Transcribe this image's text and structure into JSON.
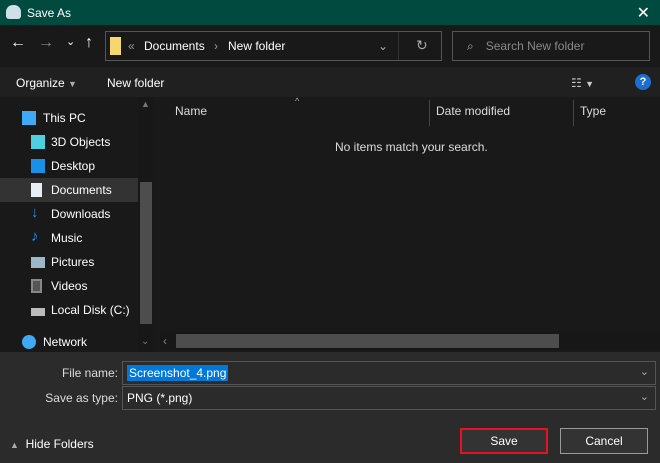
{
  "window": {
    "title": "Save As",
    "close": "✕"
  },
  "nav": {
    "back": "←",
    "forward": "→",
    "recent": "⌄",
    "up": "↑",
    "breadcrumb_overflow": "«",
    "breadcrumb": [
      "Documents",
      "New folder"
    ],
    "refresh": "↻",
    "search_placeholder": "Search New folder"
  },
  "toolbar": {
    "organize": "Organize",
    "new_folder": "New folder",
    "help": "?"
  },
  "sidebar": {
    "items": [
      {
        "label": "This PC",
        "icon": "computer-icon",
        "color": "#3fa9f5"
      },
      {
        "label": "3D Objects",
        "icon": "cube-icon",
        "color": "#4fd0e0"
      },
      {
        "label": "Desktop",
        "icon": "desktop-icon",
        "color": "#1a8fe8"
      },
      {
        "label": "Documents",
        "icon": "document-icon",
        "color": "#e8eef5",
        "selected": true
      },
      {
        "label": "Downloads",
        "icon": "download-icon",
        "color": "#2f8fe8"
      },
      {
        "label": "Music",
        "icon": "music-icon",
        "color": "#1e90ff"
      },
      {
        "label": "Pictures",
        "icon": "pictures-icon",
        "color": "#9ab8c8"
      },
      {
        "label": "Videos",
        "icon": "videos-icon",
        "color": "#777"
      },
      {
        "label": "Local Disk (C:)",
        "icon": "disk-icon",
        "color": "#bbb"
      },
      {
        "label": "Network",
        "icon": "network-icon",
        "color": "#3fa9f5"
      }
    ]
  },
  "filelist": {
    "columns": [
      "Name",
      "Date modified",
      "Type"
    ],
    "empty_message": "No items match your search."
  },
  "form": {
    "file_name_label": "File name:",
    "file_name_value": "Screenshot_4.png",
    "type_label": "Save as type:",
    "type_value": "PNG (*.png)"
  },
  "footer": {
    "hide_folders": "Hide Folders",
    "save": "Save",
    "cancel": "Cancel"
  },
  "colors": {
    "title_bar": "#004a3f",
    "selection": "#0078d7",
    "highlight": "#e81123"
  }
}
